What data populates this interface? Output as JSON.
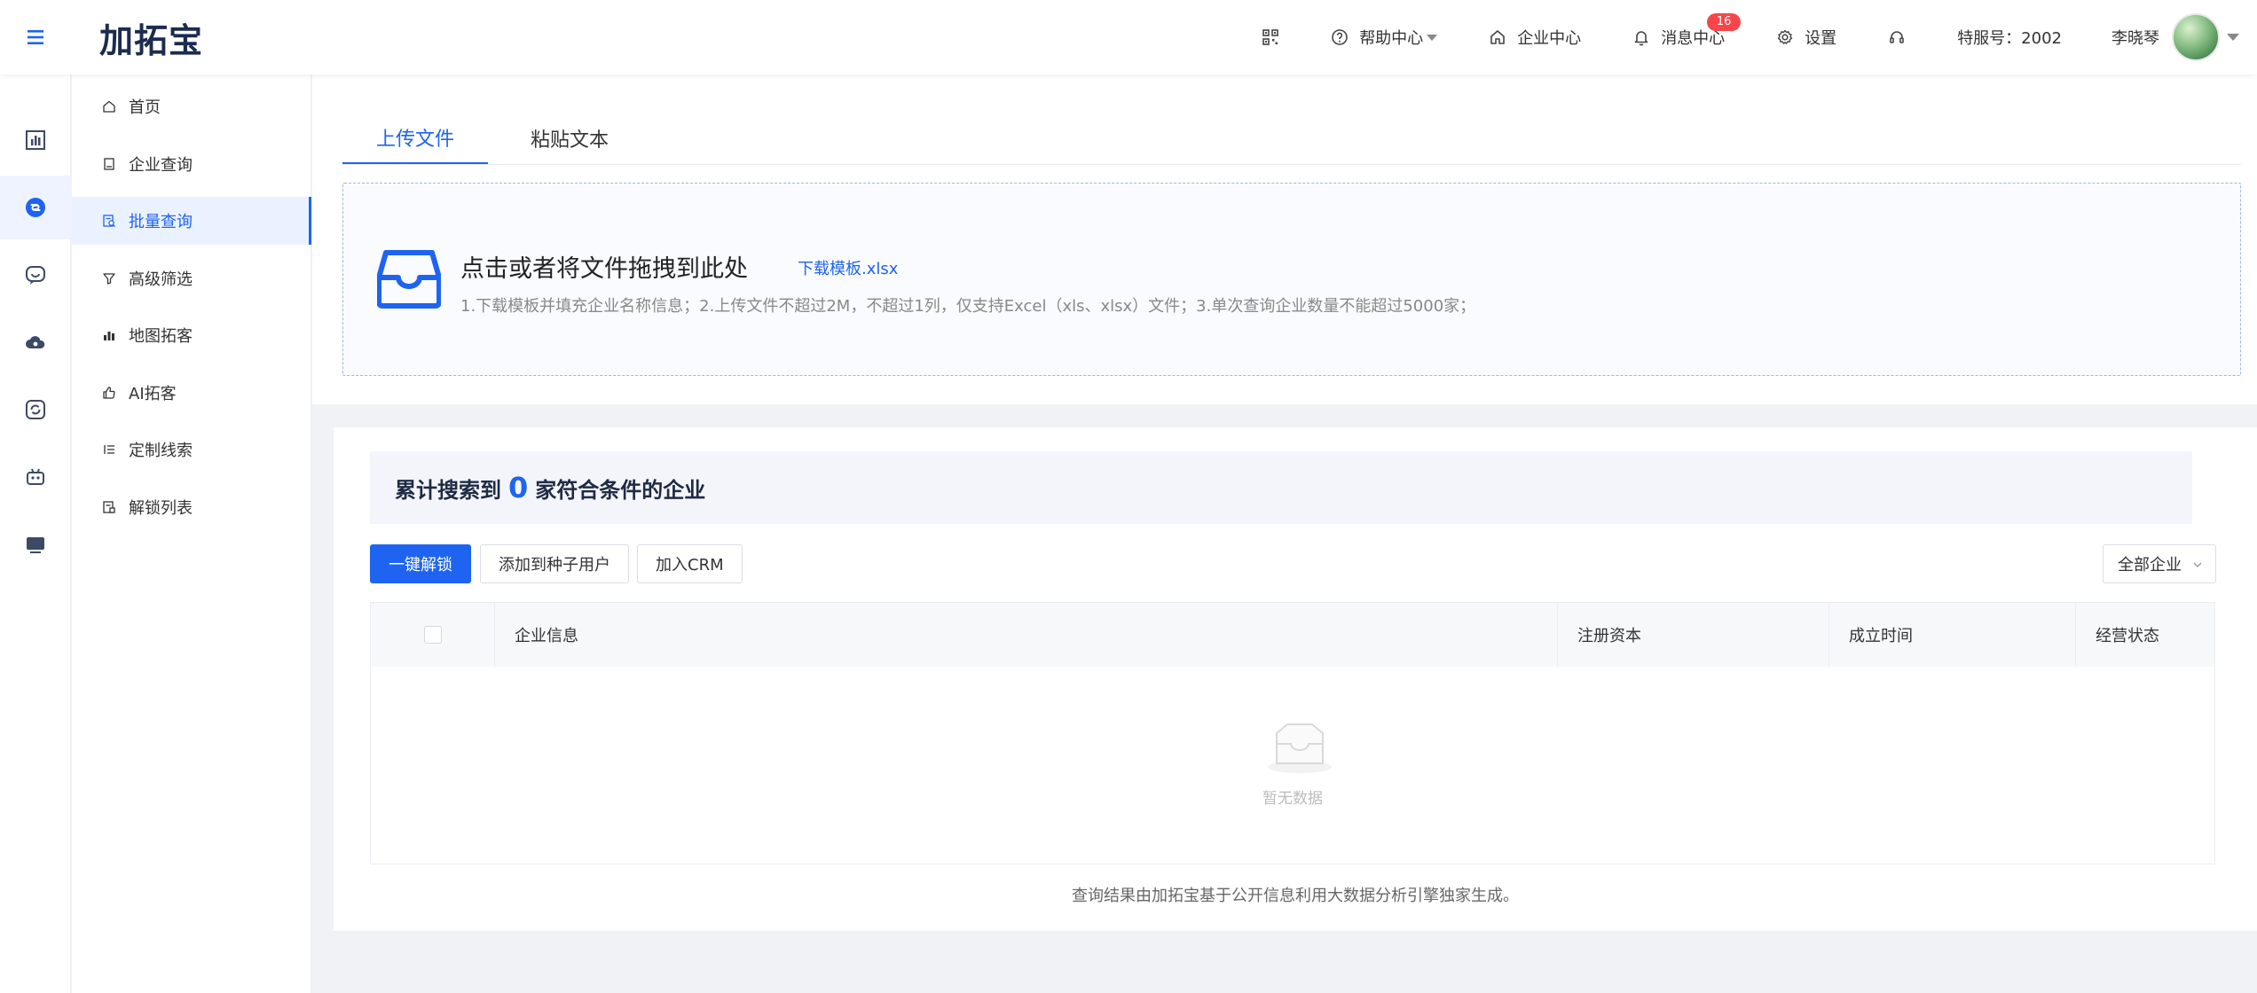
{
  "header": {
    "logo": "加拓宝",
    "help": "帮助中心",
    "enterprise_center": "企业中心",
    "messages": "消息中心",
    "messages_badge": "16",
    "settings": "设置",
    "service_no": "特服号：2002",
    "username": "李晓琴"
  },
  "sidebar": {
    "items": [
      {
        "label": "首页"
      },
      {
        "label": "企业查询"
      },
      {
        "label": "批量查询"
      },
      {
        "label": "高级筛选"
      },
      {
        "label": "地图拓客"
      },
      {
        "label": "AI拓客"
      },
      {
        "label": "定制线索"
      },
      {
        "label": "解锁列表"
      }
    ],
    "active_index": 2
  },
  "upload": {
    "tabs": [
      {
        "label": "上传文件"
      },
      {
        "label": "粘贴文本"
      }
    ],
    "active_tab": 0,
    "title": "点击或者将文件拖拽到此处",
    "template_link": "下载模板.xlsx",
    "tip": "1.下载模板并填充企业名称信息；2.上传文件不超过2M，不超过1列，仅支持Excel（xls、xlsx）文件；3.单次查询企业数量不能超过5000家；"
  },
  "result": {
    "summary_prefix": "累计搜索到",
    "count": "0",
    "summary_suffix": "家符合条件的企业",
    "actions": {
      "unlock": "一键解锁",
      "add_seed": "添加到种子用户",
      "add_crm": "加入CRM"
    },
    "filter": "全部企业",
    "columns": {
      "company": "企业信息",
      "capital": "注册资本",
      "founded": "成立时间",
      "status": "经营状态"
    },
    "empty": "暂无数据",
    "footnote": "查询结果由加拓宝基于公开信息利用大数据分析引擎独家生成。"
  },
  "colors": {
    "primary": "#1e64f0",
    "badge": "#f5474b",
    "logo": "#1c2b4f"
  }
}
